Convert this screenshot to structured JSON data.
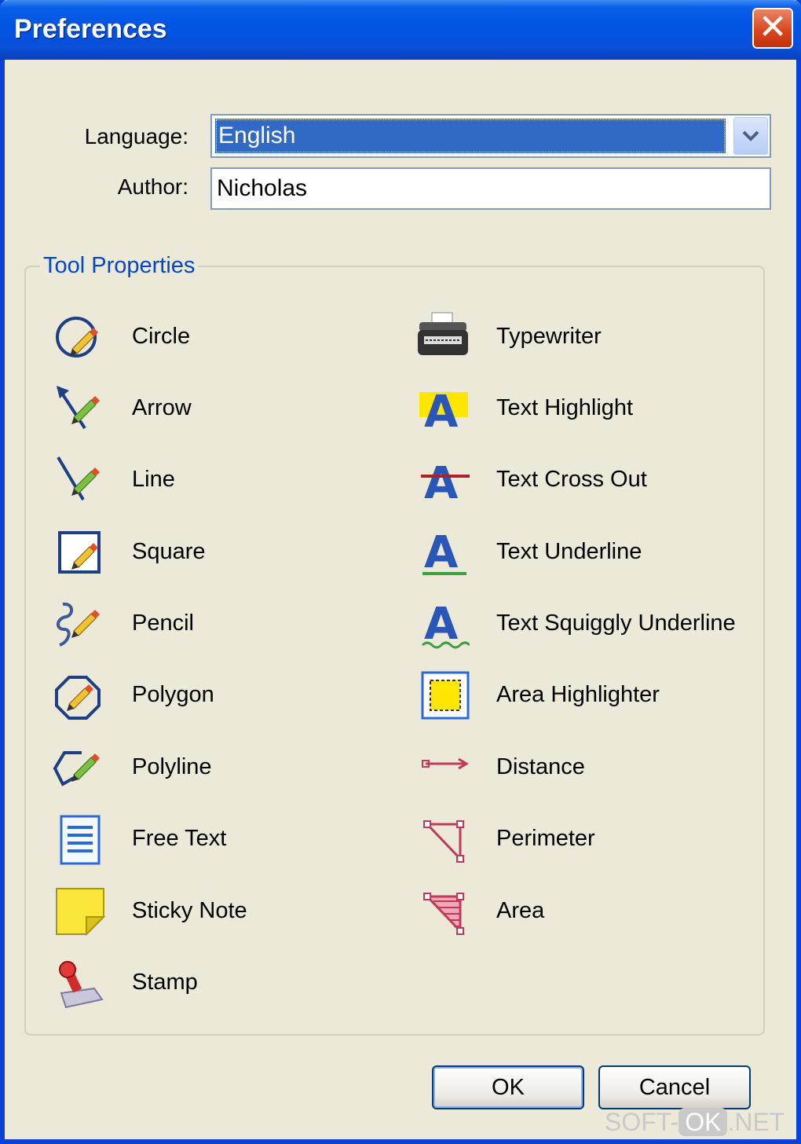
{
  "window": {
    "title": "Preferences",
    "close_label": "✕"
  },
  "form": {
    "language_label": "Language:",
    "language_value": "English",
    "author_label": "Author:",
    "author_value": "Nicholas"
  },
  "tool_properties": {
    "title": "Tool Properties",
    "left_tools": [
      {
        "label": "Circle",
        "icon": "circle-pencil-icon"
      },
      {
        "label": "Arrow",
        "icon": "arrow-pencil-icon"
      },
      {
        "label": "Line",
        "icon": "line-pencil-icon"
      },
      {
        "label": "Square",
        "icon": "square-pencil-icon"
      },
      {
        "label": "Pencil",
        "icon": "freehand-pencil-icon"
      },
      {
        "label": "Polygon",
        "icon": "polygon-pencil-icon"
      },
      {
        "label": "Polyline",
        "icon": "polyline-pencil-icon"
      },
      {
        "label": "Free Text",
        "icon": "free-text-icon"
      },
      {
        "label": "Sticky Note",
        "icon": "sticky-note-icon"
      },
      {
        "label": "Stamp",
        "icon": "stamp-icon"
      }
    ],
    "right_tools": [
      {
        "label": "Typewriter",
        "icon": "typewriter-icon"
      },
      {
        "label": "Text Highlight",
        "icon": "text-highlight-icon"
      },
      {
        "label": "Text Cross Out",
        "icon": "text-cross-out-icon"
      },
      {
        "label": "Text Underline",
        "icon": "text-underline-icon"
      },
      {
        "label": "Text Squiggly Underline",
        "icon": "text-squiggly-icon"
      },
      {
        "label": "Area Highlighter",
        "icon": "area-highlighter-icon"
      },
      {
        "label": "Distance",
        "icon": "distance-icon"
      },
      {
        "label": "Perimeter",
        "icon": "perimeter-icon"
      },
      {
        "label": "Area",
        "icon": "area-measure-icon"
      }
    ]
  },
  "buttons": {
    "ok": "OK",
    "cancel": "Cancel"
  },
  "watermark": {
    "left": "SOFT-",
    "middle": "OK",
    "right": ".NET"
  },
  "colors": {
    "titlebar": "#0054e3",
    "dialog_bg": "#ece9d8",
    "group_title": "#0046d5",
    "selection": "#316ac5"
  }
}
